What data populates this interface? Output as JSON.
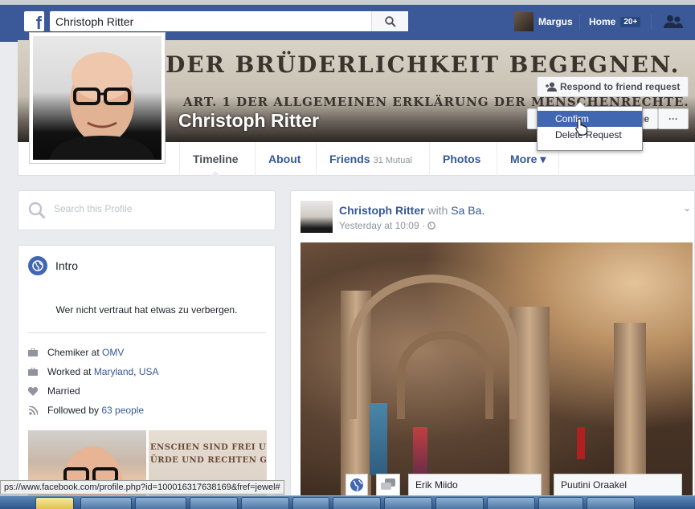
{
  "topbar": {
    "logo": "f",
    "search_value": "Christoph Ritter",
    "user_name": "Margus",
    "home_label": "Home",
    "home_badge": "20+"
  },
  "cover": {
    "line1": "DER BRÜDERLICHKEIT BEGEGNEN.",
    "line2": "ART. 1 DER ALLGEMEINEN ERKLÄRUNG DER MENSCHENRECHTE.",
    "profile_name": "Christoph Ritter"
  },
  "actions": {
    "respond_label": "Respond to friend request",
    "message_label": "Message",
    "more_dots": "···",
    "dropdown": [
      "Confirm",
      "Delete Request"
    ]
  },
  "tabs": [
    {
      "label": "Timeline"
    },
    {
      "label": "About"
    },
    {
      "label": "Friends",
      "sub": "31 Mutual"
    },
    {
      "label": "Photos"
    },
    {
      "label": "More ▾"
    }
  ],
  "sidebar": {
    "search_placeholder": "Search this Profile",
    "intro_title": "Intro",
    "bio": "Wer nicht vertraut hat etwas zu verbergen.",
    "job_prefix": "Chemiker at ",
    "job_link": "OMV",
    "worked_prefix": "Worked at ",
    "worked_link1": "Maryland",
    "worked_sep": ", ",
    "worked_link2": "USA",
    "relationship": "Married",
    "followed_prefix": "Followed by ",
    "followed_link": "63 people",
    "photo2_lines": [
      "ENSCHEN SIND FREI UND",
      "ÜRDE UND RECHTEN GEBO"
    ]
  },
  "post": {
    "author": "Christoph Ritter",
    "with_text": " with ",
    "tagged": "Sa Ba.",
    "time": "Yesterday at 10:09 · "
  },
  "chat": {
    "tab1": "Erik Miido",
    "tab2": "Puutini Oraakel"
  },
  "status_url": "ps://www.facebook.com/profile.php?id=100016317638169&fref=jewel#"
}
